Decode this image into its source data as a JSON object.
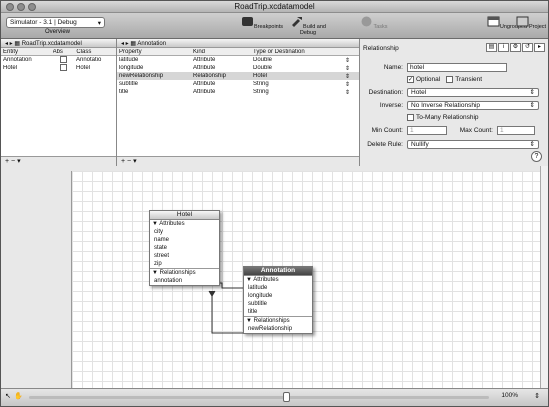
{
  "window": {
    "title": "RoadTrip.xcdatamodel"
  },
  "toolbar": {
    "scheme": "Simulator - 3.1 | Debug",
    "overview": "Overview",
    "breakpoints": "Breakpoints",
    "build_debug": "Build and Debug",
    "tasks": "Tasks",
    "ungrouped": "Ungrouped",
    "project": "Project"
  },
  "entity_pane": {
    "path": "RoadTrip.xcdatamodel",
    "headers": [
      "Entity",
      "Abs",
      "Class"
    ],
    "rows": [
      [
        "Annotation",
        "Annotatio"
      ],
      [
        "Hotel",
        "Hotel"
      ]
    ]
  },
  "property_pane": {
    "path": "Annotation",
    "headers": [
      "Property",
      "Kind",
      "Type or Destination"
    ],
    "rows": [
      [
        "latitude",
        "Attribute",
        "Double"
      ],
      [
        "longitude",
        "Attribute",
        "Double"
      ],
      [
        "newRelationship",
        "Relationship",
        "Hotel"
      ],
      [
        "subtitle",
        "Attribute",
        "String"
      ],
      [
        "title",
        "Attribute",
        "String"
      ]
    ]
  },
  "inspector": {
    "heading": "Relationship",
    "name_label": "Name:",
    "name_value": "hotel",
    "optional": "Optional",
    "transient": "Transient",
    "destination_label": "Destination:",
    "destination_value": "Hotel",
    "inverse_label": "Inverse:",
    "inverse_value": "No Inverse Relationship",
    "to_many": "To-Many Relationship",
    "min_label": "Min Count:",
    "min_value": "1",
    "max_label": "Max Count:",
    "max_value": "1",
    "delete_label": "Delete Rule:",
    "delete_value": "Nullify",
    "help": "?"
  },
  "diagram": {
    "hotel": {
      "title": "Hotel",
      "attr_header": "Attributes",
      "attrs": [
        "city",
        "name",
        "state",
        "street",
        "zip"
      ],
      "rel_header": "Relationships",
      "rels": [
        "annotation"
      ]
    },
    "annotation": {
      "title": "Annotation",
      "attr_header": "Attributes",
      "attrs": [
        "latitude",
        "longitude",
        "subtitle",
        "title"
      ],
      "rel_header": "Relationships",
      "rels": [
        "newRelationship"
      ]
    }
  },
  "status": {
    "zoom": "100%"
  }
}
